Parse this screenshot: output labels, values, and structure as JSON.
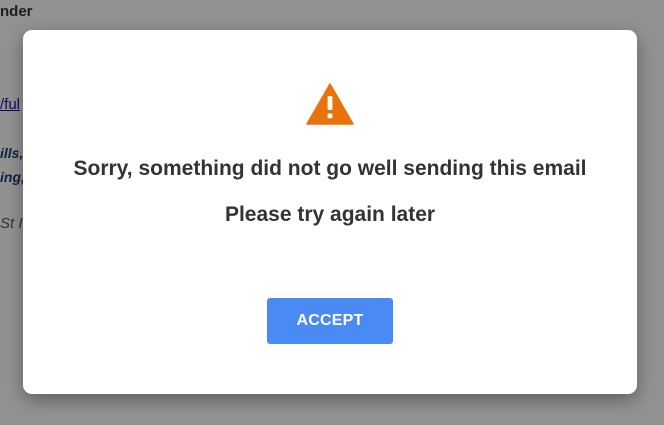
{
  "background": {
    "heading_fragment": "nder",
    "link_fragment": "/ful",
    "bold_fragment_1": "ills,",
    "bold_fragment_2": "ing,",
    "italic_fragment": "St I"
  },
  "dialog": {
    "icon": "warning-triangle-icon",
    "icon_color": "#e8720c",
    "message": "Sorry, something did not go well sending this email",
    "submessage": "Please try again later",
    "accept_label": "ACCEPT",
    "accept_color": "#4a8af4"
  }
}
